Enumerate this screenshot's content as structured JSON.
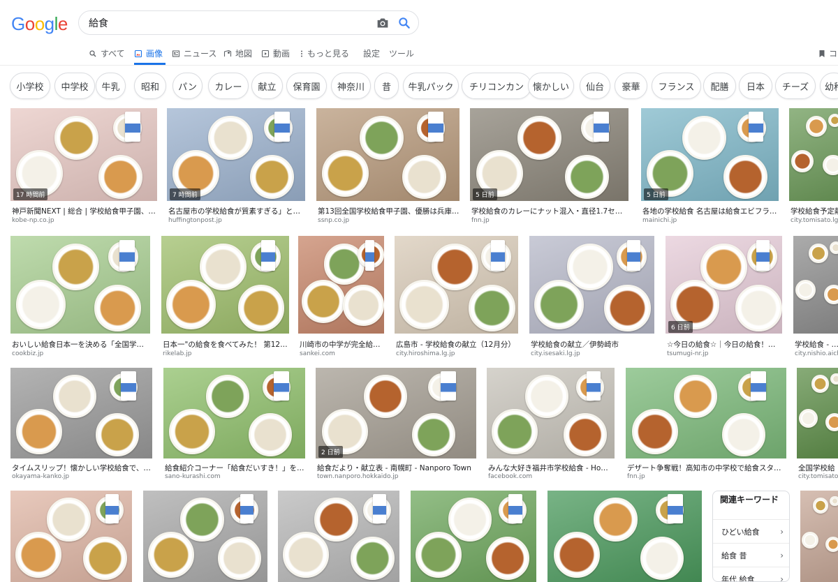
{
  "header": {
    "logo": "Google",
    "logo_colors": [
      "#4285F4",
      "#EA4335",
      "#FBBC05",
      "#4285F4",
      "#34A853",
      "#EA4335"
    ],
    "query": "給食"
  },
  "tabs": [
    {
      "label": "すべて",
      "icon": "search-icon"
    },
    {
      "label": "画像",
      "icon": "image-icon"
    },
    {
      "label": "ニュース",
      "icon": "news-icon"
    },
    {
      "label": "地図",
      "icon": "map-icon"
    },
    {
      "label": "動画",
      "icon": "video-icon"
    },
    {
      "label": "もっと見る",
      "icon": "more-icon"
    },
    {
      "label": "設定"
    },
    {
      "label": "ツール"
    },
    {
      "label": "コレ",
      "icon": "bookmark-icon"
    }
  ],
  "chips": [
    "小学校",
    "中学校",
    "牛乳",
    "昭和",
    "パン",
    "カレー",
    "献立",
    "保育園",
    "神奈川",
    "昔",
    "牛乳パック",
    "チリコンカン",
    "懐かしい",
    "仙台",
    "豪華",
    "フランス",
    "配膳",
    "日本",
    "チーズ",
    "幼稚"
  ],
  "results": [
    {
      "caption": "神戸新聞NEXT | 総合 | 学校給食甲子園、兵庫...",
      "domain": "kobe-np.co.jp",
      "badge": "17 時間前",
      "tray": "#e8c9c4"
    },
    {
      "caption": "名古屋市の学校給食が質素すぎる」とネッ...",
      "domain": "huffingtonpost.jp",
      "badge": "7 時間前",
      "tray": "#9db3cf"
    },
    {
      "caption": "第13回全国学校給食甲子園、優勝は兵庫県・...",
      "domain": "ssnp.co.jp",
      "badge": "",
      "tray": "#b89a7c"
    },
    {
      "caption": "学校給食のカレーにナット混入・直径1.7センチが...",
      "domain": "fnn.jp",
      "badge": "5 日前",
      "tray": "#8a8478"
    },
    {
      "caption": "各地の学校給食 名古屋は給食エビフライ年...",
      "domain": "mainichi.jp",
      "badge": "5 日前",
      "tray": "#7fb8c9"
    },
    {
      "caption": "学校給食予定献",
      "domain": "city.tomisato.lg.j",
      "badge": "",
      "tray": "#6d9b5a"
    },
    {
      "caption": "おいしい給食日本一を決める「全国学校給...",
      "domain": "cookbiz.jp",
      "badge": "",
      "tray": "#a9cf92"
    },
    {
      "caption": "日本一\"の給食を食べてみた！ 第12回全...",
      "domain": "rikelab.jp",
      "badge": "",
      "tray": "#9fbf6c"
    },
    {
      "caption": "川崎市の中学が完全給食...",
      "domain": "sankei.com",
      "badge": "",
      "tray": "#c7866a"
    },
    {
      "caption": "広島市 - 学校給食の献立（12月分）",
      "domain": "city.hiroshima.lg.jp",
      "badge": "",
      "tray": "#d9cbb8"
    },
    {
      "caption": "学校給食の献立／伊勢崎市",
      "domain": "city.isesaki.lg.jp",
      "badge": "",
      "tray": "#b7b9c9"
    },
    {
      "caption": "☆今日の給食☆｜今日の給食！つむ...",
      "domain": "tsumugi-nr.jp",
      "badge": "6 日前",
      "tray": "#e6ccd8"
    },
    {
      "caption": "学校給食 - 西尾",
      "domain": "city.nishio.aichi",
      "badge": "",
      "tray": "#8f8f8f"
    },
    {
      "caption": "タイムスリップ！懐かしい学校給食で、青春...",
      "domain": "okayama-kanko.jp",
      "badge": "",
      "tray": "#9a9a9a"
    },
    {
      "caption": "給食紹介コーナー「給食だいすき！」を公開...",
      "domain": "sano-kurashi.com",
      "badge": "",
      "tray": "#8fc06b"
    },
    {
      "caption": "給食だより・献立表 - 南幌町 - Nanporo Town",
      "domain": "town.nanporo.hokkaido.jp",
      "badge": "2 日前",
      "tray": "#a59e93"
    },
    {
      "caption": "みんな大好き福井市学校給食 - Home | F...",
      "domain": "facebook.com",
      "badge": "",
      "tray": "#c8c4bb"
    },
    {
      "caption": "デザート争奪戦！高知市の中学校で給食スタート -...",
      "domain": "fnn.jp",
      "badge": "",
      "tray": "#7cba7a"
    },
    {
      "caption": "全国学校給",
      "domain": "city.tomisato",
      "badge": "",
      "tray": "#5f8f4a"
    },
    {
      "caption": "",
      "domain": "",
      "badge": "",
      "tray": "#e0b7a6"
    },
    {
      "caption": "",
      "domain": "",
      "badge": "",
      "tray": "#aaaaaa"
    },
    {
      "caption": "",
      "domain": "",
      "badge": "",
      "tray": "#b8b8b8"
    },
    {
      "caption": "",
      "domain": "",
      "badge": "",
      "tray": "#6fa85e"
    },
    {
      "caption": "",
      "domain": "",
      "badge": "",
      "tray": "#4b9a5d"
    },
    {
      "caption": "",
      "domain": "",
      "badge": "",
      "tray": "#c8a999"
    }
  ],
  "related": {
    "title": "関連キーワード",
    "items": [
      "ひどい給食",
      "給食 昔",
      "年代 給食"
    ]
  }
}
